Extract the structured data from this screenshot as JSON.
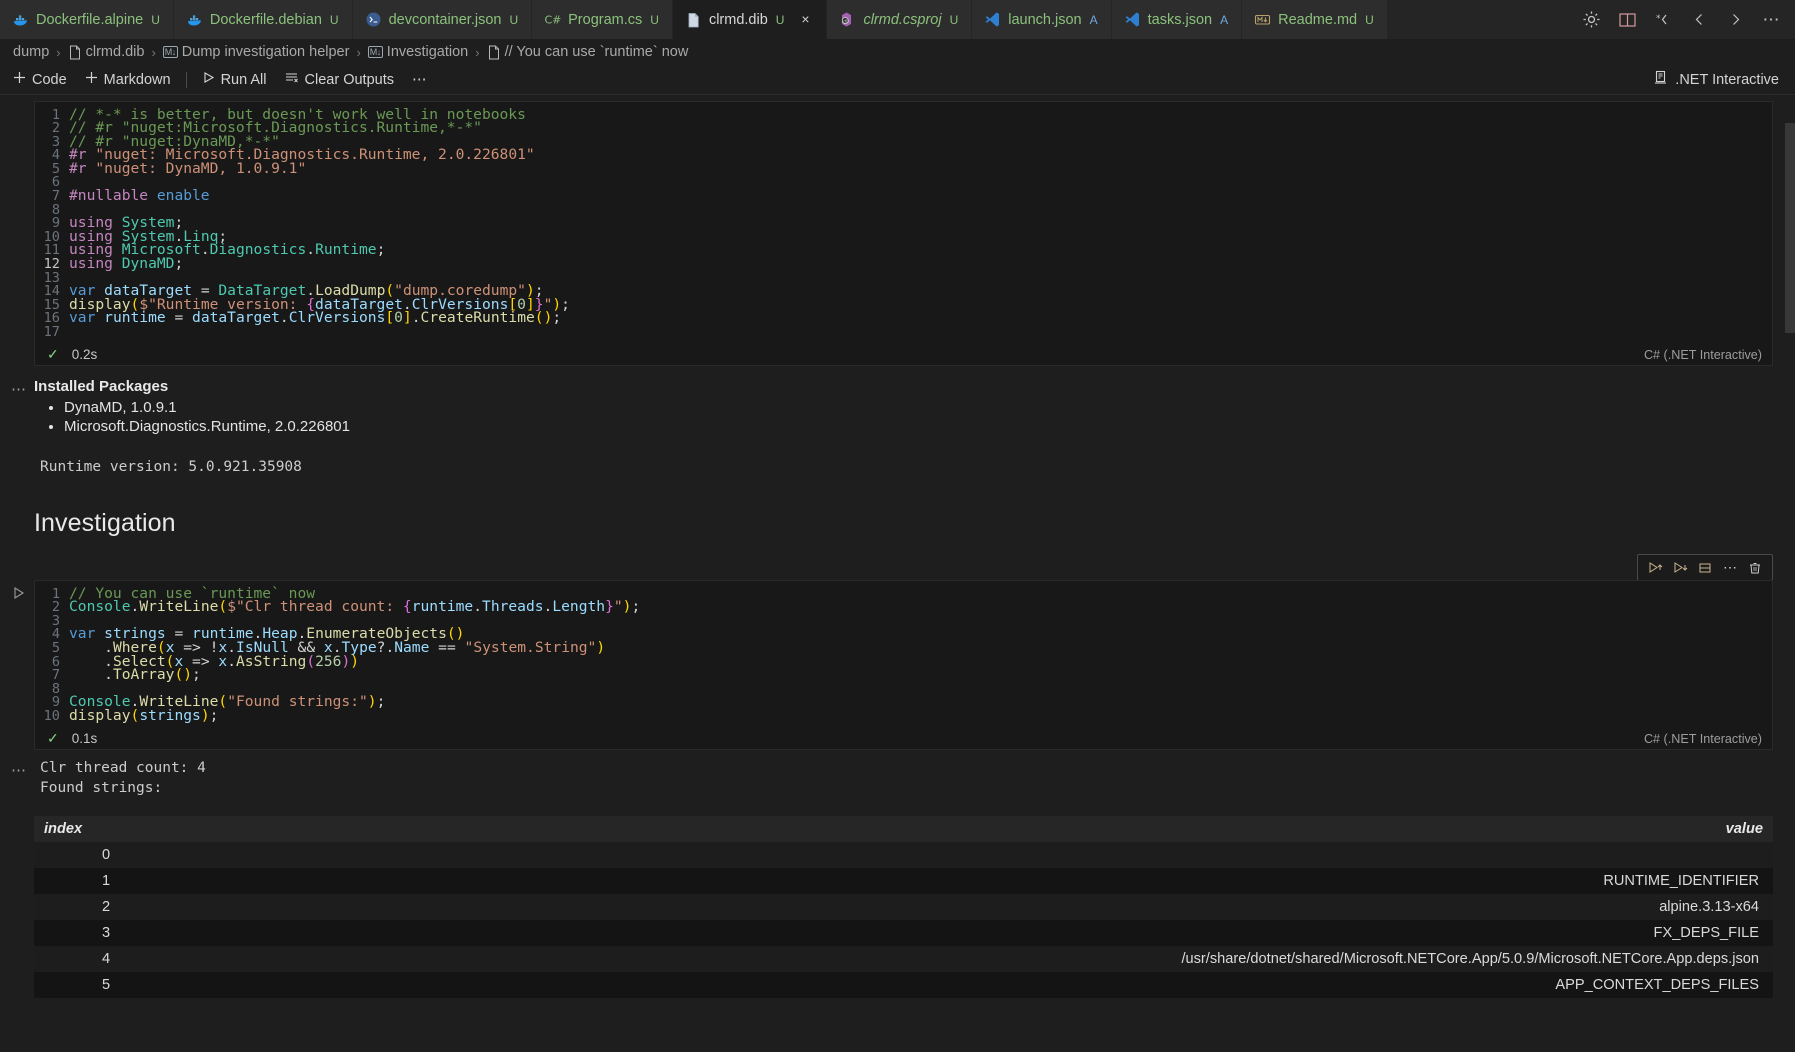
{
  "tabs": [
    {
      "label": "Dockerfile.alpine",
      "badge": "U",
      "icon": "docker-icon",
      "active": false,
      "italic": false
    },
    {
      "label": "Dockerfile.debian",
      "badge": "U",
      "icon": "docker-icon",
      "active": false,
      "italic": false
    },
    {
      "label": "devcontainer.json",
      "badge": "U",
      "icon": "devcontainer-icon",
      "active": false,
      "italic": false
    },
    {
      "label": "Program.cs",
      "badge": "U",
      "icon": "csharp-icon",
      "active": false,
      "italic": false
    },
    {
      "label": "clrmd.dib",
      "badge": "U",
      "icon": "file-icon",
      "active": true,
      "italic": false,
      "close": "×"
    },
    {
      "label": "clrmd.csproj",
      "badge": "U",
      "icon": "csproj-icon",
      "active": false,
      "italic": true
    },
    {
      "label": "launch.json",
      "badge": "A",
      "icon": "vscode-icon",
      "active": false,
      "italic": false
    },
    {
      "label": "tasks.json",
      "badge": "A",
      "icon": "vscode-icon",
      "active": false,
      "italic": false
    },
    {
      "label": "Readme.md",
      "badge": "U",
      "icon": "markdown-icon",
      "active": false,
      "italic": false
    }
  ],
  "tab_actions": [
    {
      "name": "gear-icon",
      "glyph": "⚙"
    },
    {
      "name": "split-editor-icon",
      "glyph": "▥"
    },
    {
      "name": "run-icon",
      "glyph": "*‹"
    },
    {
      "name": "chevron-left-icon",
      "glyph": "‹"
    },
    {
      "name": "chevron-right-icon",
      "glyph": "›"
    },
    {
      "name": "more-actions-icon",
      "glyph": "⋯"
    }
  ],
  "breadcrumb": [
    {
      "label": "dump",
      "icon": null
    },
    {
      "label": "clrmd.dib",
      "icon": "file-icon"
    },
    {
      "label": "Dump investigation helper",
      "icon": "markdown-icon"
    },
    {
      "label": "Investigation",
      "icon": "markdown-icon"
    },
    {
      "label": "// You can use `runtime` now",
      "icon": "file-icon"
    }
  ],
  "toolbar": {
    "code_label": "Code",
    "markdown_label": "Markdown",
    "run_all_label": "Run All",
    "clear_outputs_label": "Clear Outputs",
    "more_label": "⋯",
    "kernel_label": ".NET Interactive"
  },
  "cells": [
    {
      "id": "cell-1",
      "type": "code",
      "current_line": 12,
      "lines": [
        [
          {
            "t": "// *-* is better, but doesn't work well in notebooks",
            "c": "c-com"
          }
        ],
        [
          {
            "t": "// #r \"nuget:Microsoft.Diagnostics.Runtime,*-*\"",
            "c": "c-com"
          }
        ],
        [
          {
            "t": "// #r \"nuget:DynaMD,*-*\"",
            "c": "c-com"
          }
        ],
        [
          {
            "t": "#r",
            "c": "c-pre"
          },
          {
            "t": " ",
            "c": "c-id"
          },
          {
            "t": "\"nuget: Microsoft.Diagnostics.Runtime, 2.0.226801\"",
            "c": "c-str"
          }
        ],
        [
          {
            "t": "#r",
            "c": "c-pre"
          },
          {
            "t": " ",
            "c": "c-id"
          },
          {
            "t": "\"nuget: DynaMD, 1.0.9.1\"",
            "c": "c-str"
          }
        ],
        [],
        [
          {
            "t": "#nullable",
            "c": "c-kwp"
          },
          {
            "t": " ",
            "c": "c-id"
          },
          {
            "t": "enable",
            "c": "c-kw"
          }
        ],
        [],
        [
          {
            "t": "using",
            "c": "c-kwp"
          },
          {
            "t": " ",
            "c": "c-id"
          },
          {
            "t": "System",
            "c": "c-typ"
          },
          {
            "t": ";",
            "c": "c-pun"
          }
        ],
        [
          {
            "t": "using",
            "c": "c-kwp"
          },
          {
            "t": " ",
            "c": "c-id"
          },
          {
            "t": "System",
            "c": "c-typ"
          },
          {
            "t": ".",
            "c": "c-pun"
          },
          {
            "t": "Linq",
            "c": "c-typ"
          },
          {
            "t": ";",
            "c": "c-pun"
          }
        ],
        [
          {
            "t": "using",
            "c": "c-kwp"
          },
          {
            "t": " ",
            "c": "c-id"
          },
          {
            "t": "Microsoft",
            "c": "c-typ"
          },
          {
            "t": ".",
            "c": "c-pun"
          },
          {
            "t": "Diagnostics",
            "c": "c-typ"
          },
          {
            "t": ".",
            "c": "c-pun"
          },
          {
            "t": "Runtime",
            "c": "c-typ"
          },
          {
            "t": ";",
            "c": "c-pun"
          }
        ],
        [
          {
            "t": "using",
            "c": "c-kwp"
          },
          {
            "t": " ",
            "c": "c-id"
          },
          {
            "t": "DynaMD",
            "c": "c-typ"
          },
          {
            "t": ";",
            "c": "c-pun"
          }
        ],
        [],
        [
          {
            "t": "var",
            "c": "c-kw"
          },
          {
            "t": " ",
            "c": "c-id"
          },
          {
            "t": "dataTarget",
            "c": "c-var"
          },
          {
            "t": " = ",
            "c": "c-op"
          },
          {
            "t": "DataTarget",
            "c": "c-typ"
          },
          {
            "t": ".",
            "c": "c-pun"
          },
          {
            "t": "LoadDump",
            "c": "c-fn"
          },
          {
            "t": "(",
            "c": "c-brk"
          },
          {
            "t": "\"dump.coredump\"",
            "c": "c-str"
          },
          {
            "t": ")",
            "c": "c-brk"
          },
          {
            "t": ";",
            "c": "c-pun"
          }
        ],
        [
          {
            "t": "display",
            "c": "c-fn"
          },
          {
            "t": "(",
            "c": "c-brk"
          },
          {
            "t": "$\"Runtime version: ",
            "c": "c-str"
          },
          {
            "t": "{",
            "c": "c-brk2"
          },
          {
            "t": "dataTarget",
            "c": "c-var"
          },
          {
            "t": ".",
            "c": "c-pun"
          },
          {
            "t": "ClrVersions",
            "c": "c-var"
          },
          {
            "t": "[",
            "c": "c-brk"
          },
          {
            "t": "0",
            "c": "c-num"
          },
          {
            "t": "]",
            "c": "c-brk"
          },
          {
            "t": "}",
            "c": "c-brk2"
          },
          {
            "t": "\"",
            "c": "c-str"
          },
          {
            "t": ")",
            "c": "c-brk"
          },
          {
            "t": ";",
            "c": "c-pun"
          }
        ],
        [
          {
            "t": "var",
            "c": "c-kw"
          },
          {
            "t": " ",
            "c": "c-id"
          },
          {
            "t": "runtime",
            "c": "c-var"
          },
          {
            "t": " = ",
            "c": "c-op"
          },
          {
            "t": "dataTarget",
            "c": "c-var"
          },
          {
            "t": ".",
            "c": "c-pun"
          },
          {
            "t": "ClrVersions",
            "c": "c-var"
          },
          {
            "t": "[",
            "c": "c-brk"
          },
          {
            "t": "0",
            "c": "c-num"
          },
          {
            "t": "]",
            "c": "c-brk"
          },
          {
            "t": ".",
            "c": "c-pun"
          },
          {
            "t": "CreateRuntime",
            "c": "c-fn"
          },
          {
            "t": "()",
            "c": "c-brk"
          },
          {
            "t": ";",
            "c": "c-pun"
          }
        ],
        []
      ],
      "status": {
        "check": "✓",
        "time": "0.2s",
        "lang": "C# (.NET Interactive)"
      }
    },
    {
      "id": "cell-2",
      "type": "code",
      "current_line": 0,
      "lines": [
        [
          {
            "t": "// You can use `runtime` now",
            "c": "c-com"
          }
        ],
        [
          {
            "t": "Console",
            "c": "c-typ"
          },
          {
            "t": ".",
            "c": "c-pun"
          },
          {
            "t": "WriteLine",
            "c": "c-fn"
          },
          {
            "t": "(",
            "c": "c-brk"
          },
          {
            "t": "$\"Clr thread count: ",
            "c": "c-str"
          },
          {
            "t": "{",
            "c": "c-brk2"
          },
          {
            "t": "runtime",
            "c": "c-var"
          },
          {
            "t": ".",
            "c": "c-pun"
          },
          {
            "t": "Threads",
            "c": "c-var"
          },
          {
            "t": ".",
            "c": "c-pun"
          },
          {
            "t": "Length",
            "c": "c-var"
          },
          {
            "t": "}",
            "c": "c-brk2"
          },
          {
            "t": "\"",
            "c": "c-str"
          },
          {
            "t": ")",
            "c": "c-brk"
          },
          {
            "t": ";",
            "c": "c-pun"
          }
        ],
        [],
        [
          {
            "t": "var",
            "c": "c-kw"
          },
          {
            "t": " ",
            "c": "c-id"
          },
          {
            "t": "strings",
            "c": "c-var"
          },
          {
            "t": " = ",
            "c": "c-op"
          },
          {
            "t": "runtime",
            "c": "c-var"
          },
          {
            "t": ".",
            "c": "c-pun"
          },
          {
            "t": "Heap",
            "c": "c-var"
          },
          {
            "t": ".",
            "c": "c-pun"
          },
          {
            "t": "EnumerateObjects",
            "c": "c-fn"
          },
          {
            "t": "()",
            "c": "c-brk"
          }
        ],
        [
          {
            "t": "    ",
            "c": "c-id"
          },
          {
            "t": ".",
            "c": "c-pun"
          },
          {
            "t": "Where",
            "c": "c-fn"
          },
          {
            "t": "(",
            "c": "c-brk"
          },
          {
            "t": "x",
            "c": "c-var"
          },
          {
            "t": " => ",
            "c": "c-op"
          },
          {
            "t": "!",
            "c": "c-op"
          },
          {
            "t": "x",
            "c": "c-var"
          },
          {
            "t": ".",
            "c": "c-pun"
          },
          {
            "t": "IsNull",
            "c": "c-var"
          },
          {
            "t": " && ",
            "c": "c-op"
          },
          {
            "t": "x",
            "c": "c-var"
          },
          {
            "t": ".",
            "c": "c-pun"
          },
          {
            "t": "Type",
            "c": "c-var"
          },
          {
            "t": "?.",
            "c": "c-pun"
          },
          {
            "t": "Name",
            "c": "c-var"
          },
          {
            "t": " == ",
            "c": "c-op"
          },
          {
            "t": "\"System.String\"",
            "c": "c-str"
          },
          {
            "t": ")",
            "c": "c-brk"
          }
        ],
        [
          {
            "t": "    ",
            "c": "c-id"
          },
          {
            "t": ".",
            "c": "c-pun"
          },
          {
            "t": "Select",
            "c": "c-fn"
          },
          {
            "t": "(",
            "c": "c-brk"
          },
          {
            "t": "x",
            "c": "c-var"
          },
          {
            "t": " => ",
            "c": "c-op"
          },
          {
            "t": "x",
            "c": "c-var"
          },
          {
            "t": ".",
            "c": "c-pun"
          },
          {
            "t": "AsString",
            "c": "c-fn"
          },
          {
            "t": "(",
            "c": "c-brk2"
          },
          {
            "t": "256",
            "c": "c-num"
          },
          {
            "t": ")",
            "c": "c-brk2"
          },
          {
            "t": ")",
            "c": "c-brk"
          }
        ],
        [
          {
            "t": "    ",
            "c": "c-id"
          },
          {
            "t": ".",
            "c": "c-pun"
          },
          {
            "t": "ToArray",
            "c": "c-fn"
          },
          {
            "t": "()",
            "c": "c-brk"
          },
          {
            "t": ";",
            "c": "c-pun"
          }
        ],
        [],
        [
          {
            "t": "Console",
            "c": "c-typ"
          },
          {
            "t": ".",
            "c": "c-pun"
          },
          {
            "t": "WriteLine",
            "c": "c-fn"
          },
          {
            "t": "(",
            "c": "c-brk"
          },
          {
            "t": "\"Found strings:\"",
            "c": "c-str"
          },
          {
            "t": ")",
            "c": "c-brk"
          },
          {
            "t": ";",
            "c": "c-pun"
          }
        ],
        [
          {
            "t": "display",
            "c": "c-fn"
          },
          {
            "t": "(",
            "c": "c-brk"
          },
          {
            "t": "strings",
            "c": "c-var"
          },
          {
            "t": ")",
            "c": "c-brk"
          },
          {
            "t": ";",
            "c": "c-pun"
          }
        ]
      ],
      "status": {
        "check": "✓",
        "time": "0.1s",
        "lang": "C# (.NET Interactive)"
      },
      "toolbar_buttons": [
        {
          "name": "run-above-icon"
        },
        {
          "name": "run-below-icon"
        },
        {
          "name": "split-cell-icon"
        },
        {
          "name": "more-actions-icon"
        },
        {
          "name": "delete-cell-icon"
        }
      ]
    }
  ],
  "output_installed_packages": {
    "title": "Installed Packages",
    "items": [
      "DynaMD, 1.0.9.1",
      "Microsoft.Diagnostics.Runtime, 2.0.226801"
    ]
  },
  "output_runtime_version": "Runtime version: 5.0.921.35908",
  "markdown_heading": "Investigation",
  "output_cell2_text": [
    "Clr thread count: 4",
    "Found strings:"
  ],
  "output_table": {
    "headers": {
      "index": "index",
      "value": "value"
    },
    "rows": [
      {
        "index": "0",
        "value": ""
      },
      {
        "index": "1",
        "value": "RUNTIME_IDENTIFIER"
      },
      {
        "index": "2",
        "value": "alpine.3.13-x64"
      },
      {
        "index": "3",
        "value": "FX_DEPS_FILE"
      },
      {
        "index": "4",
        "value": "/usr/share/dotnet/shared/Microsoft.NETCore.App/5.0.9/Microsoft.NETCore.App.deps.json"
      },
      {
        "index": "5",
        "value": "APP_CONTEXT_DEPS_FILES"
      }
    ]
  },
  "colors": {
    "editor_bg": "#1e1e1e",
    "cell_bg": "#181818",
    "tab_active_bg": "#1e1e1e",
    "tab_inactive_bg": "#2d2d2d",
    "accent_green": "#8bc17c",
    "accent_blue": "#6fa8dc",
    "success": "#89d185"
  }
}
